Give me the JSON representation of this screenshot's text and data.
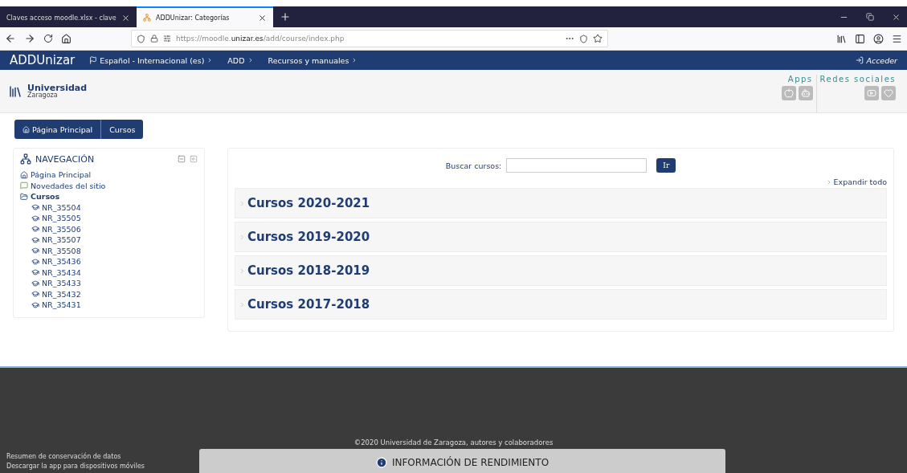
{
  "browser": {
    "tabs": [
      {
        "label": "Claves acceso moodle.xlsx - clave",
        "selected": false
      },
      {
        "label": "ADDUnizar: Categorías",
        "selected": true
      }
    ],
    "url_prefix": "https://moodle.",
    "url_domain": "unizar.es",
    "url_path": "/add/course/index.php"
  },
  "navbar": {
    "brand": "ADDUnizar",
    "menus": [
      {
        "label": "Español - Internacional (es)",
        "kind": "language"
      },
      {
        "label": "ADD",
        "kind": "menu"
      },
      {
        "label": "Recursos y manuales",
        "kind": "menu"
      }
    ],
    "login": "Acceder"
  },
  "header": {
    "logo_title": "Universidad",
    "logo_subtitle": "Zaragoza",
    "apps_label": "Apps",
    "social_label": "Redes sociales"
  },
  "breadcrumb": [
    {
      "label": "Página Principal",
      "kind": "home"
    },
    {
      "label": "Cursos",
      "kind": "page"
    }
  ],
  "navigation": {
    "title": "NAVEGACIÓN",
    "items": [
      {
        "label": "Página Principal",
        "kind": "home"
      },
      {
        "label": "Novedades del sitio",
        "kind": "forum"
      },
      {
        "label": "Cursos",
        "kind": "folder",
        "children": [
          {
            "label": "NR_35504",
            "kind": "course"
          },
          {
            "label": "NR_35505",
            "kind": "course"
          },
          {
            "label": "NR_35506",
            "kind": "course"
          },
          {
            "label": "NR_35507",
            "kind": "course"
          },
          {
            "label": "NR_35508",
            "kind": "course"
          },
          {
            "label": "NR_35436",
            "kind": "course"
          },
          {
            "label": "NR_35434",
            "kind": "course"
          },
          {
            "label": "NR_35433",
            "kind": "course"
          },
          {
            "label": "NR_35432",
            "kind": "course"
          },
          {
            "label": "NR_35431",
            "kind": "course"
          }
        ]
      }
    ]
  },
  "main": {
    "search_label": "Buscar cursos:",
    "search_button": "Ir",
    "expand_all": "Expandir todo",
    "categories": [
      {
        "label": "Cursos 2020-2021",
        "expanded": false
      },
      {
        "label": "Cursos 2019-2020",
        "expanded": false
      },
      {
        "label": "Cursos 2018-2019",
        "expanded": false
      },
      {
        "label": "Cursos 2017-2018",
        "expanded": false
      }
    ]
  },
  "footer": {
    "links": [
      "Resumen de conservación de datos",
      "Descargar la app para dispositivos móviles"
    ],
    "copyright": "©2020 Universidad de Zaragoza, autores y colaboradores",
    "performance_title": "INFORMACIÓN DE RENDIMIENTO"
  }
}
